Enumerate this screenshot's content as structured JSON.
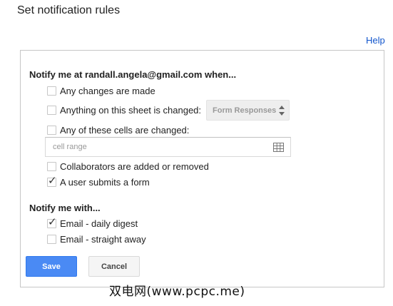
{
  "dialog": {
    "title": "Set notification rules",
    "help_label": "Help"
  },
  "notify_when": {
    "heading": "Notify me at randall.angela@gmail.com when...",
    "options": [
      {
        "label": "Any changes are made",
        "checked": false
      },
      {
        "label": "Anything on this sheet is changed:",
        "checked": false
      },
      {
        "label": "Any of these cells are changed:",
        "checked": false
      },
      {
        "label": "Collaborators are added or removed",
        "checked": false
      },
      {
        "label": "A user submits a form",
        "checked": true
      }
    ],
    "sheet_dropdown": {
      "selected": "Form Responses"
    },
    "cell_range": {
      "placeholder": "cell range",
      "value": ""
    }
  },
  "notify_with": {
    "heading": "Notify me with...",
    "options": [
      {
        "label": "Email - daily digest",
        "checked": true
      },
      {
        "label": "Email - straight away",
        "checked": false
      }
    ]
  },
  "buttons": {
    "save": "Save",
    "cancel": "Cancel"
  },
  "watermark": "双电网(www.pcpc.me)",
  "colors": {
    "primary_button": "#4a8af4",
    "link": "#1155cc",
    "border": "#c6c6c6"
  }
}
